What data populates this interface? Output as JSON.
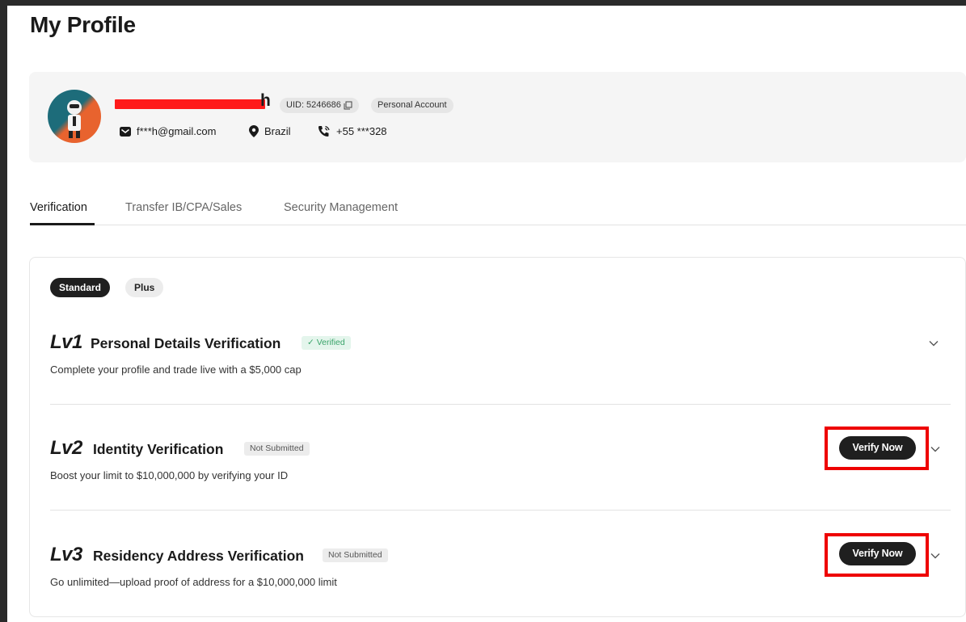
{
  "page": {
    "title": "My Profile"
  },
  "profile": {
    "name_visible_tail": "h",
    "uid_label": "UID: 5246686",
    "account_type": "Personal Account",
    "email": "f***h@gmail.com",
    "country": "Brazil",
    "phone": "+55 ***328"
  },
  "tabs": [
    {
      "label": "Verification",
      "active": true
    },
    {
      "label": "Transfer IB/CPA/Sales",
      "active": false
    },
    {
      "label": "Security Management",
      "active": false
    }
  ],
  "verification": {
    "tiers": [
      {
        "label": "Standard",
        "selected": true
      },
      {
        "label": "Plus",
        "selected": false
      }
    ],
    "levels": [
      {
        "lv": "Lv1",
        "title": "Personal Details Verification",
        "status": "Verified",
        "description": "Complete your profile and trade live with a $5,000 cap"
      },
      {
        "lv": "Lv2",
        "title": "Identity Verification",
        "status": "Not Submitted",
        "description": "Boost your limit to $10,000,000 by verifying your ID",
        "action": "Verify Now"
      },
      {
        "lv": "Lv3",
        "title": "Residency Address Verification",
        "status": "Not Submitted",
        "description": "Go unlimited—upload proof of address for a $10,000,000 limit",
        "action": "Verify Now"
      }
    ]
  },
  "colors": {
    "highlight": "#ee0000",
    "redaction": "#ff1a1a",
    "verified_text": "#3aa46a",
    "verified_bg": "#e4f5ec"
  }
}
